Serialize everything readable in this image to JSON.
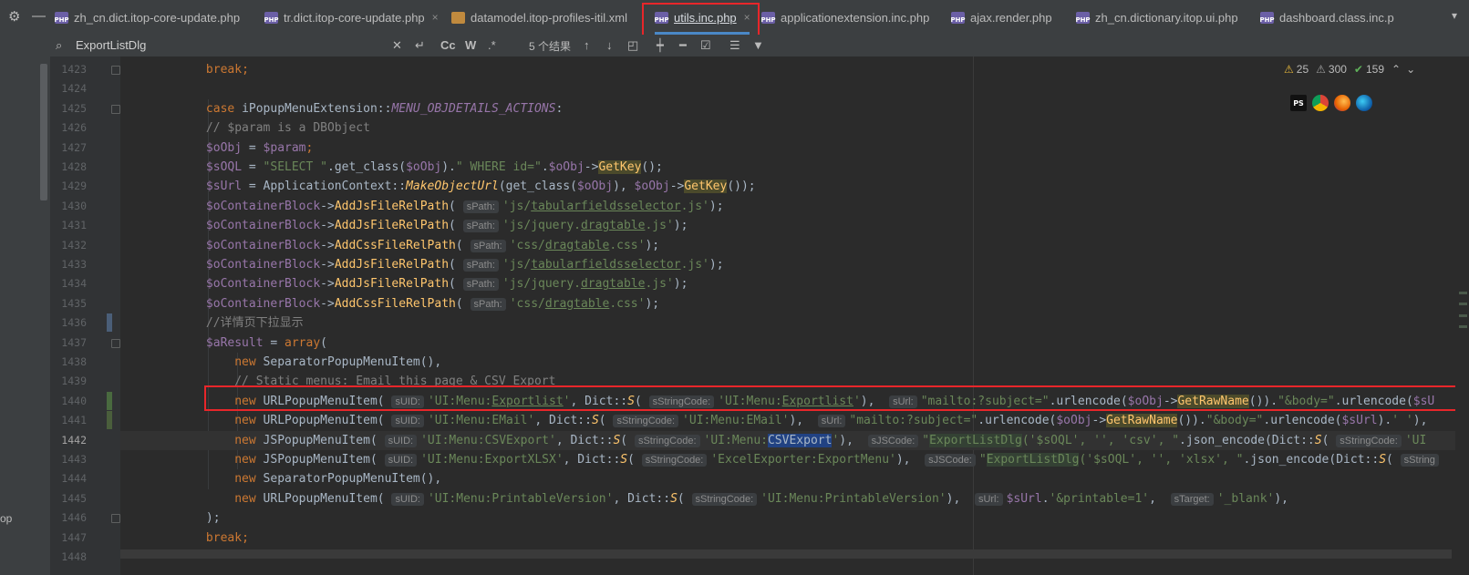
{
  "tabbar": {
    "tabs": [
      {
        "label": "zh_cn.dict.itop-core-update.php",
        "type": "php"
      },
      {
        "label": "tr.dict.itop-core-update.php",
        "type": "php"
      },
      {
        "label": "datamodel.itop-profiles-itil.xml",
        "type": "xml"
      },
      {
        "label": "utils.inc.php",
        "type": "php",
        "active": true
      },
      {
        "label": "applicationextension.inc.php",
        "type": "php"
      },
      {
        "label": "ajax.render.php",
        "type": "php"
      },
      {
        "label": "zh_cn.dictionary.itop.ui.php",
        "type": "php"
      },
      {
        "label": "dashboard.class.inc.p",
        "type": "php"
      }
    ],
    "file_icon_text": "PHP",
    "close_glyph": "×"
  },
  "findbar": {
    "query": "ExportListDlg",
    "case_label": "Cc",
    "word_label": "W",
    "regex_label": ".*",
    "results": "5 个结果"
  },
  "left_panel": {
    "text": "op"
  },
  "inspections": {
    "warnings": "25",
    "weak_warnings": "300",
    "ok": "159"
  },
  "browsers": [
    "PS",
    "Chrome",
    "Firefox",
    "Edge"
  ],
  "lines": [
    {
      "n": "1423",
      "segs": [
        [
          "            ",
          ""
        ],
        [
          "break",
          "kw"
        ],
        [
          ";",
          "kw"
        ]
      ]
    },
    {
      "n": "1424",
      "segs": []
    },
    {
      "n": "1425",
      "segs": [
        [
          "            ",
          ""
        ],
        [
          "case ",
          "kw"
        ],
        [
          "iPopupMenuExtension::",
          ""
        ],
        [
          "MENU_OBJDETAILS_ACTIONS",
          "const"
        ],
        [
          ":",
          ""
        ]
      ]
    },
    {
      "n": "1426",
      "segs": [
        [
          "            ",
          ""
        ],
        [
          "// $param is a DBObject",
          "cmt"
        ]
      ]
    },
    {
      "n": "1427",
      "segs": [
        [
          "            ",
          ""
        ],
        [
          "$oObj",
          "var"
        ],
        [
          " = ",
          ""
        ],
        [
          "$param",
          "var"
        ],
        [
          ";",
          "kw"
        ]
      ]
    },
    {
      "n": "1428",
      "segs": [
        [
          "            ",
          ""
        ],
        [
          "$sOQL",
          "var"
        ],
        [
          " = ",
          ""
        ],
        [
          "\"SELECT \"",
          "str"
        ],
        [
          ".get_class(",
          ""
        ],
        [
          "$oObj",
          "var"
        ],
        [
          ").",
          ""
        ],
        [
          "\" WHERE id=\"",
          "str"
        ],
        [
          ".",
          ""
        ],
        [
          "$oObj",
          "var"
        ],
        [
          "->",
          ""
        ],
        [
          "GetKey",
          "mkfn"
        ],
        [
          "();",
          ""
        ]
      ]
    },
    {
      "n": "1429",
      "segs": [
        [
          "            ",
          ""
        ],
        [
          "$sUrl",
          "var"
        ],
        [
          " = ApplicationContext::",
          ""
        ],
        [
          "MakeObjectUrl",
          "fnit"
        ],
        [
          "(get_class(",
          ""
        ],
        [
          "$oObj",
          "var"
        ],
        [
          "), ",
          ""
        ],
        [
          "$oObj",
          "var"
        ],
        [
          "->",
          ""
        ],
        [
          "GetKey",
          "mkfn"
        ],
        [
          "());",
          ""
        ]
      ]
    },
    {
      "n": "1430",
      "segs": [
        [
          "            ",
          ""
        ],
        [
          "$oContainerBlock",
          "var"
        ],
        [
          "->",
          ""
        ],
        [
          "AddJsFileRelPath",
          "fn"
        ],
        [
          "( ",
          ""
        ],
        [
          "sPath:",
          "hint"
        ],
        [
          "'js/",
          "str"
        ],
        [
          "tabularfieldsselector",
          "str ul"
        ],
        [
          ".js'",
          "str"
        ],
        [
          ");",
          ""
        ]
      ]
    },
    {
      "n": "1431",
      "segs": [
        [
          "            ",
          ""
        ],
        [
          "$oContainerBlock",
          "var"
        ],
        [
          "->",
          ""
        ],
        [
          "AddJsFileRelPath",
          "fn"
        ],
        [
          "( ",
          ""
        ],
        [
          "sPath:",
          "hint"
        ],
        [
          "'js/jquery.",
          "str"
        ],
        [
          "dragtable",
          "str ul"
        ],
        [
          ".js'",
          "str"
        ],
        [
          ");",
          ""
        ]
      ]
    },
    {
      "n": "1432",
      "segs": [
        [
          "            ",
          ""
        ],
        [
          "$oContainerBlock",
          "var"
        ],
        [
          "->",
          ""
        ],
        [
          "AddCssFileRelPath",
          "fn"
        ],
        [
          "( ",
          ""
        ],
        [
          "sPath:",
          "hint"
        ],
        [
          "'css/",
          "str"
        ],
        [
          "dragtable",
          "str ul"
        ],
        [
          ".css'",
          "str"
        ],
        [
          ");",
          ""
        ]
      ]
    },
    {
      "n": "1433",
      "segs": [
        [
          "            ",
          ""
        ],
        [
          "$oContainerBlock",
          "var"
        ],
        [
          "->",
          ""
        ],
        [
          "AddJsFileRelPath",
          "fn"
        ],
        [
          "( ",
          ""
        ],
        [
          "sPath:",
          "hint"
        ],
        [
          "'js/",
          "str"
        ],
        [
          "tabularfieldsselector",
          "str ul"
        ],
        [
          ".js'",
          "str"
        ],
        [
          ");",
          ""
        ]
      ]
    },
    {
      "n": "1434",
      "segs": [
        [
          "            ",
          ""
        ],
        [
          "$oContainerBlock",
          "var"
        ],
        [
          "->",
          ""
        ],
        [
          "AddJsFileRelPath",
          "fn"
        ],
        [
          "( ",
          ""
        ],
        [
          "sPath:",
          "hint"
        ],
        [
          "'js/jquery.",
          "str"
        ],
        [
          "dragtable",
          "str ul"
        ],
        [
          ".js'",
          "str"
        ],
        [
          ");",
          ""
        ]
      ]
    },
    {
      "n": "1435",
      "segs": [
        [
          "            ",
          ""
        ],
        [
          "$oContainerBlock",
          "var"
        ],
        [
          "->",
          ""
        ],
        [
          "AddCssFileRelPath",
          "fn"
        ],
        [
          "( ",
          ""
        ],
        [
          "sPath:",
          "hint"
        ],
        [
          "'css/",
          "str"
        ],
        [
          "dragtable",
          "str ul"
        ],
        [
          ".css'",
          "str"
        ],
        [
          ");",
          ""
        ]
      ]
    },
    {
      "n": "1436",
      "segs": [
        [
          "            ",
          ""
        ],
        [
          "//详情页下拉显示",
          "cmt"
        ]
      ]
    },
    {
      "n": "1437",
      "segs": [
        [
          "            ",
          ""
        ],
        [
          "$aResult",
          "var"
        ],
        [
          " = ",
          ""
        ],
        [
          "array",
          "kw"
        ],
        [
          "(",
          ""
        ]
      ]
    },
    {
      "n": "1438",
      "segs": [
        [
          "                ",
          ""
        ],
        [
          "new ",
          "kw"
        ],
        [
          "SeparatorPopupMenuItem(),",
          ""
        ]
      ]
    },
    {
      "n": "1439",
      "segs": [
        [
          "                ",
          ""
        ],
        [
          "// Static menus: Email this page & CSV Export",
          "cmt"
        ]
      ]
    },
    {
      "n": "1440",
      "segs": [
        [
          "                ",
          ""
        ],
        [
          "new ",
          "kw"
        ],
        [
          "URLPopupMenuItem( ",
          ""
        ],
        [
          "sUID:",
          "hint"
        ],
        [
          "'UI:Menu:",
          "str"
        ],
        [
          "Exportlist",
          "str ul"
        ],
        [
          "'",
          "str"
        ],
        [
          ", Dict::",
          ""
        ],
        [
          "S",
          "fnit"
        ],
        [
          "( ",
          ""
        ],
        [
          "sStringCode:",
          "hint"
        ],
        [
          "'UI:Menu:",
          "str"
        ],
        [
          "Exportlist",
          "str ul"
        ],
        [
          "'",
          "str"
        ],
        [
          "),  ",
          ""
        ],
        [
          "sUrl:",
          "hint"
        ],
        [
          "\"mailto:?subject=\"",
          "str"
        ],
        [
          ".urlencode(",
          ""
        ],
        [
          "$oObj",
          "var"
        ],
        [
          "->",
          ""
        ],
        [
          "GetRawName",
          "mkfn"
        ],
        [
          "()).",
          ""
        ],
        [
          "\"&body=\"",
          "str"
        ],
        [
          ".urlencode(",
          ""
        ],
        [
          "$sU",
          "var"
        ]
      ]
    },
    {
      "n": "1441",
      "segs": [
        [
          "                ",
          ""
        ],
        [
          "new ",
          "kw"
        ],
        [
          "URLPopupMenuItem( ",
          ""
        ],
        [
          "sUID:",
          "hint"
        ],
        [
          "'UI:Menu:EMail'",
          "str"
        ],
        [
          ", Dict::",
          ""
        ],
        [
          "S",
          "fnit"
        ],
        [
          "( ",
          ""
        ],
        [
          "sStringCode:",
          "hint"
        ],
        [
          "'UI:Menu:EMail'",
          "str"
        ],
        [
          "),  ",
          ""
        ],
        [
          "sUrl:",
          "hint"
        ],
        [
          "\"mailto:?subject=\"",
          "str"
        ],
        [
          ".urlencode(",
          ""
        ],
        [
          "$oObj",
          "var"
        ],
        [
          "->",
          ""
        ],
        [
          "GetRawName",
          "mkfn"
        ],
        [
          "()).",
          ""
        ],
        [
          "\"&body=\"",
          "str"
        ],
        [
          ".urlencode(",
          ""
        ],
        [
          "$sUrl",
          "var"
        ],
        [
          ").",
          ""
        ],
        [
          "' '",
          "str"
        ],
        [
          "),",
          ""
        ]
      ]
    },
    {
      "n": "1442",
      "cur": true,
      "segs": [
        [
          "                ",
          ""
        ],
        [
          "new ",
          "kw"
        ],
        [
          "JSPopupMenuItem( ",
          ""
        ],
        [
          "sUID:",
          "hint"
        ],
        [
          "'UI:Menu:CSVExport'",
          "str"
        ],
        [
          ", Dict::",
          ""
        ],
        [
          "S",
          "fnit"
        ],
        [
          "( ",
          ""
        ],
        [
          "sStringCode:",
          "hint"
        ],
        [
          "'UI:Menu:",
          "str"
        ],
        [
          "CSVExport",
          "sel"
        ],
        [
          "'",
          "str"
        ],
        [
          "),  ",
          ""
        ],
        [
          "sJSCode:",
          "hint"
        ],
        [
          "\"",
          "str"
        ],
        [
          "ExportListDlg",
          "str mk"
        ],
        [
          "('$sOQL', '', 'csv', \"",
          "str"
        ],
        [
          ".json_encode(Dict::",
          ""
        ],
        [
          "S",
          "fnit"
        ],
        [
          "( ",
          ""
        ],
        [
          "sStringCode:",
          "hint"
        ],
        [
          "'UI",
          "str"
        ]
      ]
    },
    {
      "n": "1443",
      "segs": [
        [
          "                ",
          ""
        ],
        [
          "new ",
          "kw"
        ],
        [
          "JSPopupMenuItem( ",
          ""
        ],
        [
          "sUID:",
          "hint"
        ],
        [
          "'UI:Menu:ExportXLSX'",
          "str"
        ],
        [
          ", Dict::",
          ""
        ],
        [
          "S",
          "fnit"
        ],
        [
          "( ",
          ""
        ],
        [
          "sStringCode:",
          "hint"
        ],
        [
          "'ExcelExporter:ExportMenu'",
          "str"
        ],
        [
          "),  ",
          ""
        ],
        [
          "sJSCode:",
          "hint"
        ],
        [
          "\"",
          "str"
        ],
        [
          "ExportListDlg",
          "str mk"
        ],
        [
          "('$sOQL', '', 'xlsx', \"",
          "str"
        ],
        [
          ".json_encode(Dict::",
          ""
        ],
        [
          "S",
          "fnit"
        ],
        [
          "( ",
          ""
        ],
        [
          "sString",
          "hint"
        ]
      ]
    },
    {
      "n": "1444",
      "segs": [
        [
          "                ",
          ""
        ],
        [
          "new ",
          "kw"
        ],
        [
          "SeparatorPopupMenuItem(),",
          ""
        ]
      ]
    },
    {
      "n": "1445",
      "segs": [
        [
          "                ",
          ""
        ],
        [
          "new ",
          "kw"
        ],
        [
          "URLPopupMenuItem( ",
          ""
        ],
        [
          "sUID:",
          "hint"
        ],
        [
          "'UI:Menu:PrintableVersion'",
          "str"
        ],
        [
          ", Dict::",
          ""
        ],
        [
          "S",
          "fnit"
        ],
        [
          "( ",
          ""
        ],
        [
          "sStringCode:",
          "hint"
        ],
        [
          "'UI:Menu:PrintableVersion'",
          "str"
        ],
        [
          "),  ",
          ""
        ],
        [
          "sUrl:",
          "hint"
        ],
        [
          "$sUrl",
          "var"
        ],
        [
          ".",
          ""
        ],
        [
          "'&printable=1'",
          "str"
        ],
        [
          ",  ",
          ""
        ],
        [
          "sTarget:",
          "hint"
        ],
        [
          "'_blank'",
          "str"
        ],
        [
          "),",
          ""
        ]
      ]
    },
    {
      "n": "1446",
      "segs": [
        [
          "            ",
          ""
        ],
        [
          ");",
          ""
        ]
      ]
    },
    {
      "n": "1447",
      "segs": [
        [
          "            ",
          ""
        ],
        [
          "break",
          "kw"
        ],
        [
          ";",
          "kw"
        ]
      ]
    },
    {
      "n": "1448",
      "segs": []
    }
  ]
}
